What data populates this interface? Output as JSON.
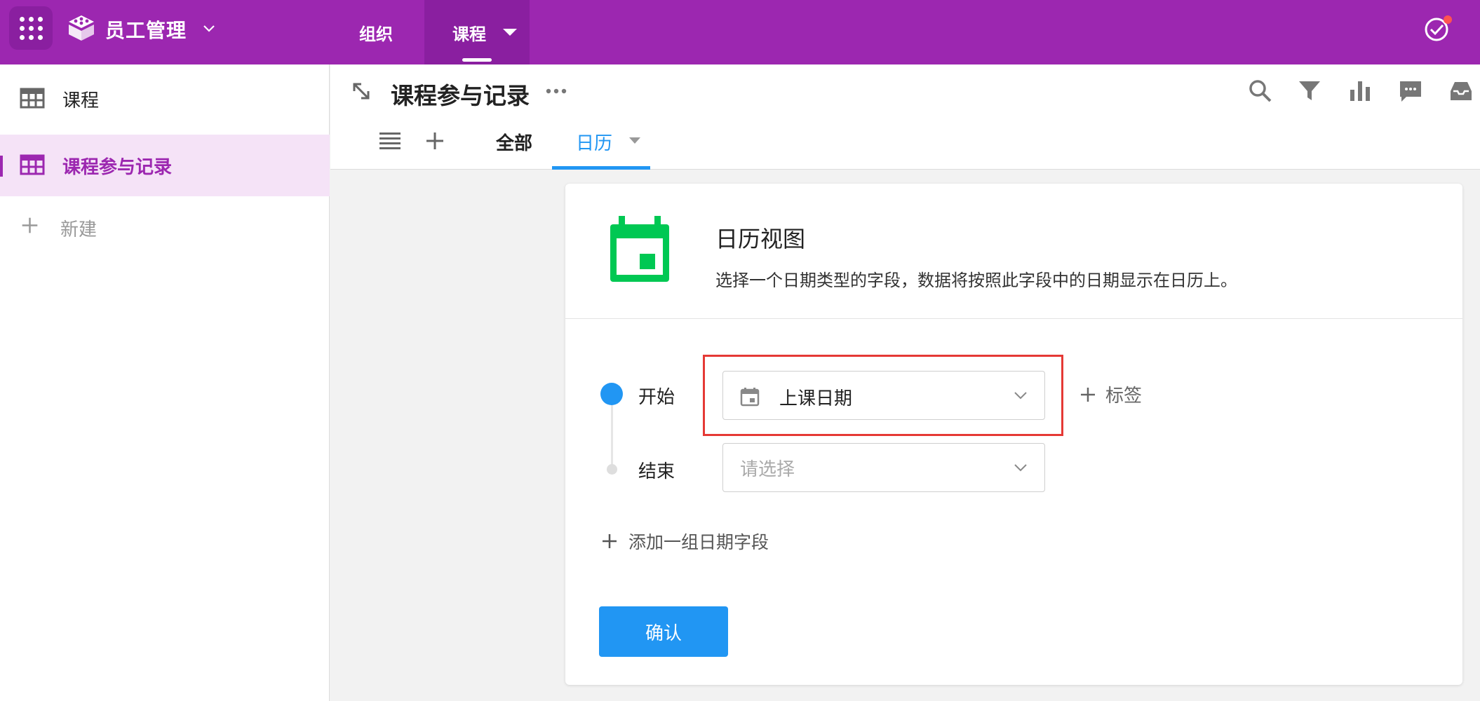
{
  "app": {
    "name": "员工管理",
    "brand_color": "#9c27b0"
  },
  "topnav": {
    "tabs": [
      {
        "label": "组织",
        "active": false
      },
      {
        "label": "课程",
        "active": true
      }
    ]
  },
  "sidebar": {
    "items": [
      {
        "label": "课程",
        "icon": "table-icon",
        "active": false
      },
      {
        "label": "课程参与记录",
        "icon": "table-icon",
        "active": true
      }
    ],
    "new_label": "新建"
  },
  "header": {
    "title": "课程参与记录",
    "tools": [
      "search-icon",
      "filter-icon",
      "chart-icon",
      "comment-icon",
      "inbox-icon"
    ],
    "views": [
      {
        "label": "全部",
        "active": false
      },
      {
        "label": "日历",
        "active": true
      }
    ]
  },
  "calendar_setup": {
    "title": "日历视图",
    "description": "选择一个日期类型的字段，数据将按照此字段中的日期显示在日历上。",
    "icon_color": "#00c853",
    "start_label": "开始",
    "start_value": "上课日期",
    "end_label": "结束",
    "end_placeholder": "请选择",
    "tag_label": "标签",
    "add_group_label": "添加一组日期字段",
    "confirm_label": "确认",
    "accent_color": "#2196f3"
  }
}
